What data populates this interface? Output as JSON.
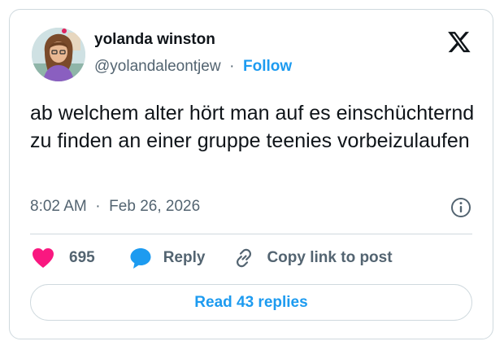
{
  "author": {
    "name": "yolanda winston",
    "handle": "@yolandaleontjew",
    "separator": "·",
    "follow_label": "Follow"
  },
  "brand": {
    "logo_icon": "x-logo-icon"
  },
  "tweet": {
    "text": "ab welchem alter hört man auf es einschüchternd zu finden an einer gruppe teenies vorbeizulaufen",
    "time": "8:02 AM",
    "separator": "·",
    "date": "Feb 26, 2026",
    "info_icon": "info-icon"
  },
  "actions": {
    "like_icon": "heart-icon",
    "like_count": "695",
    "reply_icon": "speech-bubble-icon",
    "reply_label": "Reply",
    "copy_icon": "link-icon",
    "copy_label": "Copy link to post"
  },
  "footer": {
    "read_replies_label": "Read 43 replies"
  },
  "colors": {
    "text": "#0f1419",
    "secondary": "#536471",
    "accent": "#1d9bf0",
    "like": "#f91880",
    "border": "#cfd9de"
  }
}
